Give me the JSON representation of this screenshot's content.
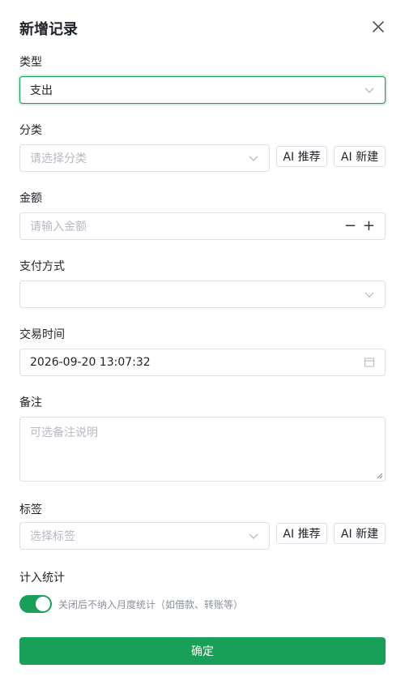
{
  "dialog": {
    "title": "新增记录",
    "close_icon": "close-icon"
  },
  "type": {
    "label": "类型",
    "value": "支出"
  },
  "category": {
    "label": "分类",
    "placeholder": "请选择分类",
    "ai_recommend_label": "AI 推荐",
    "ai_create_label": "AI 新建"
  },
  "amount": {
    "label": "金额",
    "placeholder": "请输入金额",
    "decrement": "−",
    "increment": "+"
  },
  "payment": {
    "label": "支付方式",
    "value": ""
  },
  "time": {
    "label": "交易时间",
    "value": "2026-09-20 13:07:32"
  },
  "note": {
    "label": "备注",
    "placeholder": "可选备注说明"
  },
  "tags": {
    "label": "标签",
    "placeholder": "选择标签",
    "ai_recommend_label": "AI 推荐",
    "ai_create_label": "AI 新建"
  },
  "stats": {
    "label": "计入统计",
    "enabled": true,
    "hint": "关闭后不纳入月度统计（如借款、转账等）"
  },
  "submit": {
    "label": "确定"
  },
  "colors": {
    "primary": "#18a058",
    "border": "#dcdfe6",
    "placeholder": "#b6bac2"
  }
}
